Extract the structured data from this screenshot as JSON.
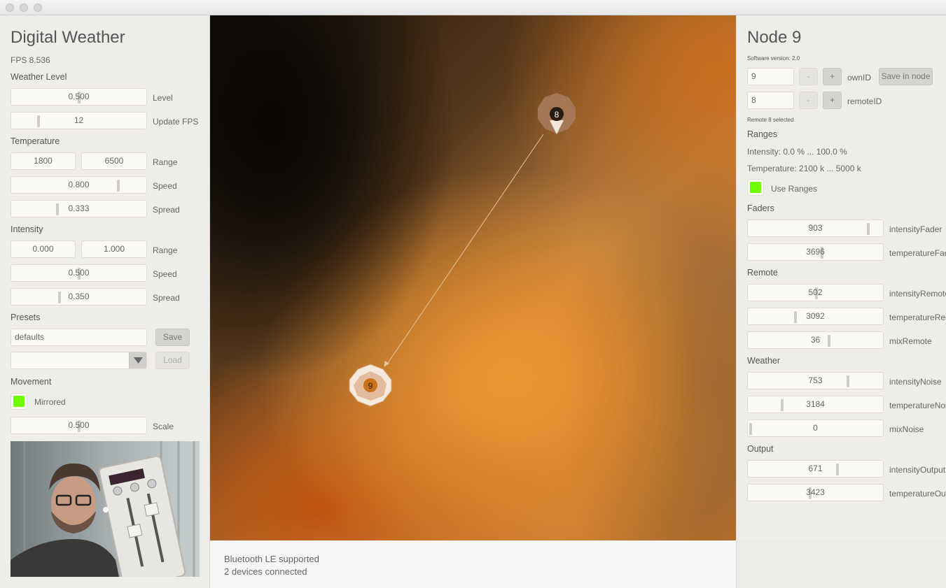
{
  "left": {
    "title": "Digital Weather",
    "fps": "FPS 8.536",
    "weather_level": {
      "heading": "Weather Level",
      "level": {
        "value": "0.500",
        "label": "Level"
      },
      "update_fps": {
        "value": "12",
        "label": "Update FPS"
      }
    },
    "temperature": {
      "heading": "Temperature",
      "range_min": "1800",
      "range_max": "6500",
      "range_label": "Range",
      "speed": {
        "value": "0.800",
        "label": "Speed"
      },
      "spread": {
        "value": "0.333",
        "label": "Spread"
      }
    },
    "intensity": {
      "heading": "Intensity",
      "range_min": "0.000",
      "range_max": "1.000",
      "range_label": "Range",
      "speed": {
        "value": "0.500",
        "label": "Speed"
      },
      "spread": {
        "value": "0.350",
        "label": "Spread"
      }
    },
    "presets": {
      "heading": "Presets",
      "name_value": "defaults",
      "save_label": "Save",
      "select_value": "",
      "load_label": "Load"
    },
    "movement": {
      "heading": "Movement",
      "mirrored_label": "Mirrored",
      "mirrored_checked": true,
      "scale": {
        "value": "0.500",
        "label": "Scale"
      }
    }
  },
  "visualization": {
    "node_a_label": "8",
    "node_b_label": "9"
  },
  "status": {
    "line1": "Bluetooth LE supported",
    "line2": "2 devices connected"
  },
  "right": {
    "title": "Node 9",
    "software_version": "Software version: 2.0",
    "own_id": {
      "value": "9",
      "minus": "-",
      "plus": "+",
      "label": "ownID",
      "save_label": "Save in node"
    },
    "remote_id": {
      "value": "8",
      "minus": "-",
      "plus": "+",
      "label": "remoteID"
    },
    "remote_selected": "Remote 8 selected",
    "ranges": {
      "heading": "Ranges",
      "intensity_text": "Intensity: 0.0 %  ...  100.0 %",
      "temperature_text": "Temperature: 2100 k  ...  5000 k",
      "use_ranges_label": "Use Ranges",
      "use_ranges_checked": true
    },
    "faders": {
      "heading": "Faders",
      "intensity": {
        "value": "903",
        "label": "intensityFader"
      },
      "temperature": {
        "value": "3696",
        "label": "temperatureFader"
      }
    },
    "remote": {
      "heading": "Remote",
      "intensity": {
        "value": "502",
        "label": "intensityRemote"
      },
      "temperature": {
        "value": "3092",
        "label": "temperatureRemote"
      },
      "mix": {
        "value": "36",
        "label": "mixRemote"
      }
    },
    "weather": {
      "heading": "Weather",
      "intensity": {
        "value": "753",
        "label": "intensityNoise"
      },
      "temperature": {
        "value": "3184",
        "label": "temperatureNoise"
      },
      "mix": {
        "value": "0",
        "label": "mixNoise"
      }
    },
    "output": {
      "heading": "Output",
      "intensity": {
        "value": "671",
        "label": "intensityOutput"
      },
      "temperature": {
        "value": "3423",
        "label": "temperatureOutput"
      }
    }
  },
  "colors": {
    "check_green": "#6dff00"
  }
}
